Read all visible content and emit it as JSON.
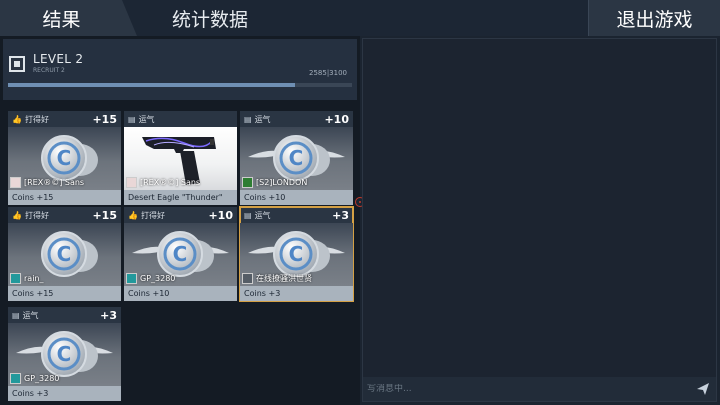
{
  "tabs": {
    "results": "结果",
    "stats": "统计数据",
    "exit": "退出游戏"
  },
  "level": {
    "title": "LEVEL 2",
    "subtitle": "RECRUIT 2",
    "xp_text": "2585|3100",
    "xp_progress": 0.834
  },
  "cards": [
    {
      "type_label": "打得好",
      "type_icon": "thumbs-up-icon",
      "points": "+15",
      "player": "[REX®©] Sans",
      "reward": "Coins +15",
      "item": "coin",
      "avatar_color": "#e9d7d7",
      "highlight": false
    },
    {
      "type_label": "运气",
      "type_icon": "luck-icon",
      "points": "",
      "player": "[REX®©] Sans",
      "reward": "Desert Eagle \"Thunder\"",
      "item": "gun",
      "avatar_color": "#e9d7d7",
      "highlight": false
    },
    {
      "type_label": "运气",
      "type_icon": "luck-icon",
      "points": "+10",
      "player": "[S2]LONDON",
      "reward": "Coins +10",
      "item": "coin-wings",
      "avatar_color": "#2e7d32",
      "highlight": false
    },
    {
      "type_label": "打得好",
      "type_icon": "thumbs-up-icon",
      "points": "+15",
      "player": "rain_",
      "reward": "Coins +15",
      "item": "coin",
      "avatar_color": "#23999c",
      "highlight": false
    },
    {
      "type_label": "打得好",
      "type_icon": "thumbs-up-icon",
      "points": "+10",
      "player": "GP_3280",
      "reward": "Coins +10",
      "item": "coin-wings",
      "avatar_color": "#23999c",
      "highlight": false
    },
    {
      "type_label": "运气",
      "type_icon": "luck-icon",
      "points": "+3",
      "player": "在线撩骚洪世贤",
      "reward": "Coins +3",
      "item": "coin-wings",
      "avatar_color": "#555d66",
      "highlight": true
    },
    {
      "type_label": "运气",
      "type_icon": "luck-icon",
      "points": "+3",
      "player": "GP_3280",
      "reward": "Coins +3",
      "item": "coin-wings",
      "avatar_color": "#23999c",
      "highlight": false
    }
  ],
  "chat": {
    "placeholder": "写消息中..."
  },
  "colors": {
    "accent": "#d4a044",
    "panel": "#2a3543",
    "footer": "#a9b3bd"
  }
}
